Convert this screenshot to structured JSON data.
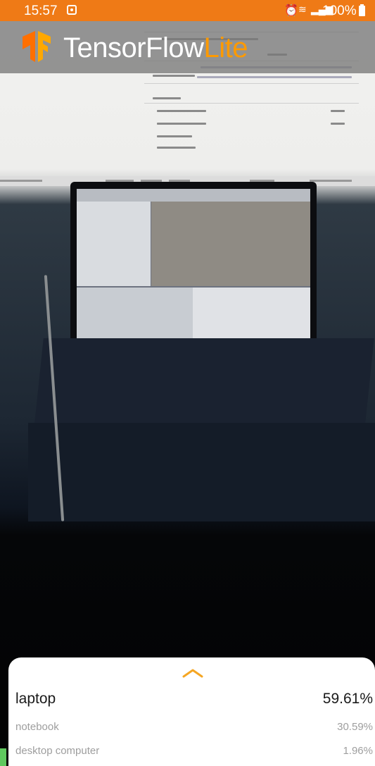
{
  "status_bar": {
    "time": "15:57",
    "battery": "100%",
    "icons": [
      "notification-icon",
      "alarm-icon",
      "wifi-icon",
      "signal-icon",
      "battery-icon"
    ]
  },
  "header": {
    "title_main": "TensorFlow",
    "title_accent": "Lite",
    "background_color": "#787878",
    "accent_color": "#ff9a00"
  },
  "results": [
    {
      "label": "laptop",
      "score": "59.61%"
    },
    {
      "label": "notebook",
      "score": "30.59%"
    },
    {
      "label": "desktop computer",
      "score": "1.96%"
    }
  ],
  "colors": {
    "status_bar": "#ef7a16",
    "chevron": "#f5a623",
    "primary_text": "#1a1a1a",
    "secondary_text": "#9e9e9e"
  }
}
